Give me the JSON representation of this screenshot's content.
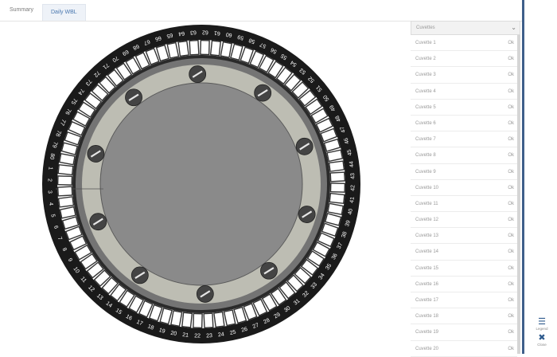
{
  "tabs": [
    "Summary",
    "Daily WBL"
  ],
  "panel": {
    "dropdown_label": "Cuvettes",
    "cuvettes": [
      {
        "name": "Cuvette 1",
        "status": "Ok"
      },
      {
        "name": "Cuvette 2",
        "status": "Ok"
      },
      {
        "name": "Cuvette 3",
        "status": "Ok"
      },
      {
        "name": "Cuvette 4",
        "status": "Ok"
      },
      {
        "name": "Cuvette 5",
        "status": "Ok"
      },
      {
        "name": "Cuvette 6",
        "status": "Ok"
      },
      {
        "name": "Cuvette 7",
        "status": "Ok"
      },
      {
        "name": "Cuvette 8",
        "status": "Ok"
      },
      {
        "name": "Cuvette 9",
        "status": "Ok"
      },
      {
        "name": "Cuvette 10",
        "status": "Ok"
      },
      {
        "name": "Cuvette 11",
        "status": "Ok"
      },
      {
        "name": "Cuvette 12",
        "status": "Ok"
      },
      {
        "name": "Cuvette 13",
        "status": "Ok"
      },
      {
        "name": "Cuvette 14",
        "status": "Ok"
      },
      {
        "name": "Cuvette 15",
        "status": "Ok"
      },
      {
        "name": "Cuvette 16",
        "status": "Ok"
      },
      {
        "name": "Cuvette 17",
        "status": "Ok"
      },
      {
        "name": "Cuvette 18",
        "status": "Ok"
      },
      {
        "name": "Cuvette 19",
        "status": "Ok"
      },
      {
        "name": "Cuvette 20",
        "status": "Ok"
      }
    ]
  },
  "wheel": {
    "cuvette_count": 80,
    "slot_numbers": [
      "1",
      "2",
      "3",
      "4",
      "5",
      "6",
      "7",
      "8",
      "9",
      "10",
      "11",
      "12",
      "13",
      "14",
      "15",
      "16",
      "17",
      "18",
      "19",
      "20",
      "21",
      "22",
      "23",
      "24",
      "25",
      "26",
      "27",
      "28",
      "29",
      "30",
      "31",
      "32",
      "33",
      "34",
      "35",
      "36",
      "37",
      "38",
      "39",
      "40",
      "41",
      "42",
      "43",
      "44",
      "45",
      "46",
      "47",
      "48",
      "49",
      "50",
      "51",
      "52",
      "53",
      "54",
      "55",
      "56",
      "57",
      "58",
      "59",
      "60",
      "61",
      "62",
      "63",
      "64",
      "65",
      "66",
      "67",
      "68",
      "69",
      "70",
      "71",
      "72",
      "73",
      "74",
      "75",
      "76",
      "77",
      "78",
      "79",
      "80"
    ],
    "screw_count": 10
  },
  "sidebar": {
    "legend_label": "Legend",
    "legend_icon": "list-icon",
    "close_label": "Close",
    "close_icon": "close-icon"
  },
  "colors": {
    "ring": "#1a1a1a",
    "slot": "#ffffff",
    "outer_band": "#747474",
    "inner_band": "#bdbdb3",
    "hub": "#8a8a8a",
    "screw": "#444444",
    "accent": "#3f5f8a"
  }
}
